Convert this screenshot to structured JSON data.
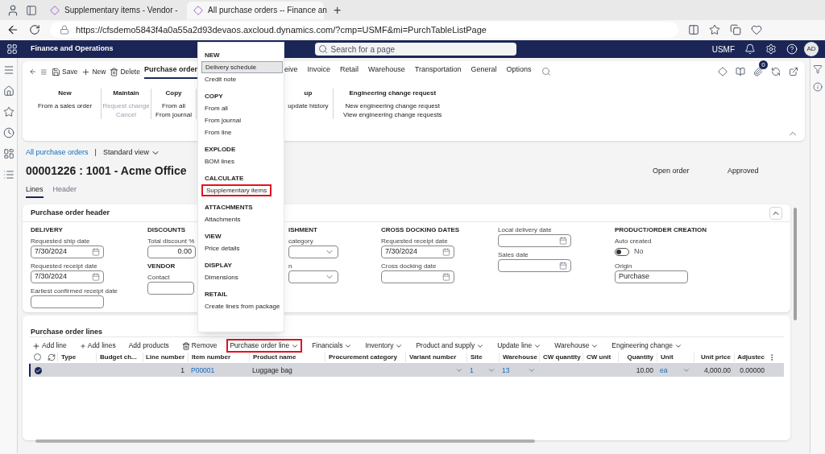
{
  "browser": {
    "tabs": [
      {
        "title": "Supplementary items - Vendor -",
        "selected": false
      },
      {
        "title": "All purchase orders -- Finance an",
        "selected": true
      }
    ],
    "new_tab": "+",
    "url": "https://cfsdemo5843f4a0a55a2d93devaos.axcloud.dynamics.com/?cmp=USMF&mi=PurchTableListPage"
  },
  "app_bar": {
    "title": "Finance and Operations",
    "search": {
      "placeholder": "Search for a page"
    },
    "company": "USMF",
    "avatar": "AD"
  },
  "action_pane": {
    "commands": [
      "Save",
      "New",
      "Delete"
    ],
    "tabs_left": [
      {
        "label": "Purchase order",
        "selected": true
      }
    ],
    "tabs_right": [
      {
        "label": "eive",
        "selected": false
      },
      {
        "label": "Invoice",
        "selected": false
      },
      {
        "label": "Retail",
        "selected": false
      },
      {
        "label": "Warehouse",
        "selected": false
      },
      {
        "label": "Transportation",
        "selected": false
      },
      {
        "label": "General",
        "selected": false
      },
      {
        "label": "Options",
        "selected": false
      }
    ],
    "badge": "0",
    "groups_left": [
      {
        "title": "New",
        "items": [
          {
            "label": "From a sales order",
            "disabled": false
          }
        ]
      },
      {
        "title": "Maintain",
        "items": [
          {
            "label": "Request change",
            "disabled": true
          },
          {
            "label": "Cancel",
            "disabled": true
          }
        ]
      },
      {
        "title": "Copy",
        "items": [
          {
            "label": "From all",
            "disabled": false
          },
          {
            "label": "From journal",
            "disabled": false
          }
        ]
      }
    ],
    "groups_right": [
      {
        "title": "up",
        "items": [
          {
            "label": "update history",
            "disabled": false
          }
        ]
      },
      {
        "title": "Engineering change request",
        "items": [
          {
            "label": "New engineering change request",
            "disabled": false
          },
          {
            "label": "View engineering change requests",
            "disabled": false
          }
        ]
      }
    ]
  },
  "breadcrumb": {
    "link": "All purchase orders",
    "separator": "|",
    "view": "Standard view"
  },
  "record": {
    "title": "00001226 : 1001 - Acme Office",
    "status": "Open order",
    "approval": "Approved"
  },
  "page_tabs": [
    {
      "label": "Lines",
      "selected": true
    },
    {
      "label": "Header",
      "selected": false
    }
  ],
  "header_card": {
    "title": "Purchase order header",
    "sections": [
      {
        "title": "DELIVERY",
        "fields": [
          {
            "kind": "date",
            "label": "Requested ship date",
            "value": "7/30/2024"
          },
          {
            "kind": "date",
            "label": "Requested receipt date",
            "value": "7/30/2024"
          },
          {
            "kind": "readonly",
            "label": "Earliest confirmed receipt date"
          }
        ]
      },
      {
        "title": "DISCOUNTS",
        "fields": [
          {
            "kind": "number",
            "label": "Total discount %",
            "value": "0.00"
          },
          {
            "kind": "heading",
            "label": "VENDOR"
          },
          {
            "kind": "text",
            "label": "Contact"
          }
        ]
      },
      {
        "title": "ISHMENT",
        "fields": [
          {
            "kind": "dropdown",
            "label": "category"
          },
          {
            "kind": "dropdown",
            "label": "n"
          }
        ]
      },
      {
        "title": "CROSS DOCKING DATES",
        "fields": [
          {
            "kind": "date",
            "label": "Requested receipt date",
            "value": "7/30/2024"
          },
          {
            "kind": "date",
            "label": "Cross docking date"
          }
        ]
      },
      {
        "fields": [
          {
            "kind": "date",
            "label": "Local delivery date"
          },
          {
            "kind": "date",
            "label": "Sales date"
          }
        ]
      },
      {
        "title": "PRODUCT/ORDER CREATION",
        "fields": [
          {
            "kind": "toggle",
            "label": "Auto created",
            "on": false,
            "value": "No"
          },
          {
            "kind": "readonly",
            "label": "Origin",
            "value": "Purchase"
          }
        ]
      }
    ]
  },
  "lines_card": {
    "title": "Purchase order lines",
    "all_selected": false,
    "toolbar": [
      {
        "kind": "add",
        "label": "Add line",
        "highlighted": false
      },
      {
        "kind": "add_many",
        "label": "Add lines",
        "highlighted": false
      },
      {
        "kind": "plain",
        "label": "Add products",
        "highlighted": false
      },
      {
        "kind": "remove",
        "label": "Remove",
        "highlighted": false
      },
      {
        "kind": "menu",
        "label": "Purchase order line",
        "highlighted": true
      },
      {
        "kind": "menu",
        "label": "Financials",
        "highlighted": false
      },
      {
        "kind": "menu",
        "label": "Inventory",
        "highlighted": false
      },
      {
        "kind": "menu",
        "label": "Product and supply",
        "highlighted": false
      },
      {
        "kind": "menu",
        "label": "Update line",
        "highlighted": false
      },
      {
        "kind": "menu",
        "label": "Warehouse",
        "highlighted": false
      },
      {
        "kind": "menu",
        "label": "Engineering change",
        "highlighted": false
      }
    ],
    "columns": [
      "Type",
      "Budget ch...",
      "Line number",
      "Item number",
      "Product name",
      "Procurement category",
      "Variant number",
      "Site",
      "Warehouse",
      "CW quantity",
      "CW unit",
      "Quantity",
      "Unit",
      "Unit price",
      "Adjustec"
    ],
    "rows": [
      {
        "selected": true,
        "cells": [
          "",
          "",
          "1",
          "P00001",
          "Luggage bag",
          "",
          "",
          "1",
          "13",
          "",
          "",
          "10.00",
          "ea",
          "4,000.00",
          "0.00000"
        ]
      }
    ]
  },
  "menu": {
    "sections": [
      {
        "title": "NEW",
        "items": [
          {
            "label": "Delivery schedule",
            "selected": true,
            "highlighted": false
          },
          {
            "label": "Credit note",
            "selected": false,
            "highlighted": false
          }
        ]
      },
      {
        "title": "COPY",
        "items": [
          {
            "label": "From all",
            "selected": false,
            "highlighted": false
          },
          {
            "label": "From journal",
            "selected": false,
            "highlighted": false
          },
          {
            "label": "From line",
            "selected": false,
            "highlighted": false
          }
        ]
      },
      {
        "title": "EXPLODE",
        "items": [
          {
            "label": "BOM lines",
            "selected": false,
            "highlighted": false
          }
        ]
      },
      {
        "title": "CALCULATE",
        "items": [
          {
            "label": "Supplementary items",
            "selected": false,
            "highlighted": true
          }
        ]
      },
      {
        "title": "ATTACHMENTS",
        "items": [
          {
            "label": "Attachments",
            "selected": false,
            "highlighted": false
          }
        ]
      },
      {
        "title": "VIEW",
        "items": [
          {
            "label": "Price details",
            "selected": false,
            "highlighted": false
          }
        ]
      },
      {
        "title": "DISPLAY",
        "items": [
          {
            "label": "Dimensions",
            "selected": false,
            "highlighted": false
          }
        ]
      },
      {
        "title": "RETAIL",
        "items": [
          {
            "label": "Create lines from package",
            "selected": false,
            "highlighted": false
          }
        ]
      }
    ]
  }
}
